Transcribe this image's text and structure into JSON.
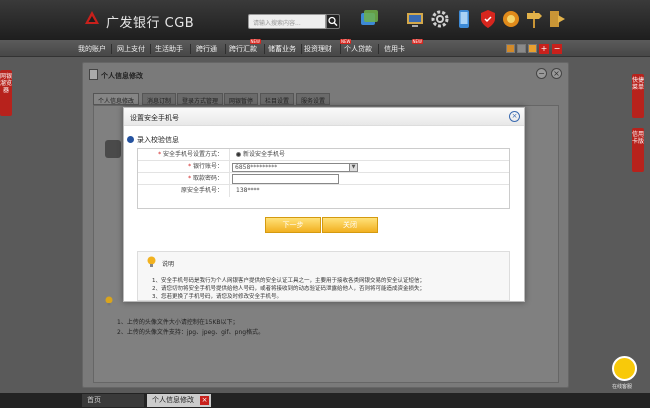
{
  "header": {
    "brand": "广发银行 CGB",
    "search_placeholder": "请输入搜索内容..."
  },
  "nav": {
    "items": [
      "我的账户",
      "网上支付",
      "生活助手",
      "跨行通",
      "跨行汇款",
      "储蓄业务",
      "投资理财",
      "个人贷款",
      "信用卡"
    ],
    "hot_label": "NEW"
  },
  "side_tabs": {
    "left": "网银溜览器",
    "right_top": "快捷菜单",
    "right_bottom": "信用卡版"
  },
  "panel": {
    "title": "个人信息修改",
    "tabs": [
      "个人信息修改",
      "消息订制",
      "登录方式管理",
      "网银暂停",
      "栏目设置",
      "服务设置"
    ],
    "notes": [
      "1、上传的头像文件大小请控制在15KB以下；",
      "2、上传的头像文件支持：jpg、jpeg、gif、png格式。"
    ]
  },
  "modal": {
    "title": "设置安全手机号",
    "section": "录入校验信息",
    "form": [
      {
        "label": "安全手机号设置方式：",
        "required": true,
        "value": "新设安全手机号"
      },
      {
        "label": "银行账号：",
        "required": true,
        "value": "6858*********"
      },
      {
        "label": "取款密码：",
        "required": true,
        "value": ""
      },
      {
        "label": "原安全手机号：",
        "required": false,
        "value": "138****"
      }
    ],
    "next_button": "下一步",
    "close_button": "关闭",
    "note_title": "说明",
    "notes": [
      "1、安全手机号码是我行为个人网银客户提供的安全认证工具之一，主要用于接收各类网银交易的安全认证短信；",
      "2、请您切勿将安全手机号提供给他人号码，或者将接收到的动态验证码泄露给他人，否则将可能造成资金损失；",
      "3、您若更换了手机号码，请您及时修改安全手机号。"
    ]
  },
  "taskbar": {
    "home": "首页",
    "current": "个人信息修改"
  },
  "customer_service": "在线客服"
}
